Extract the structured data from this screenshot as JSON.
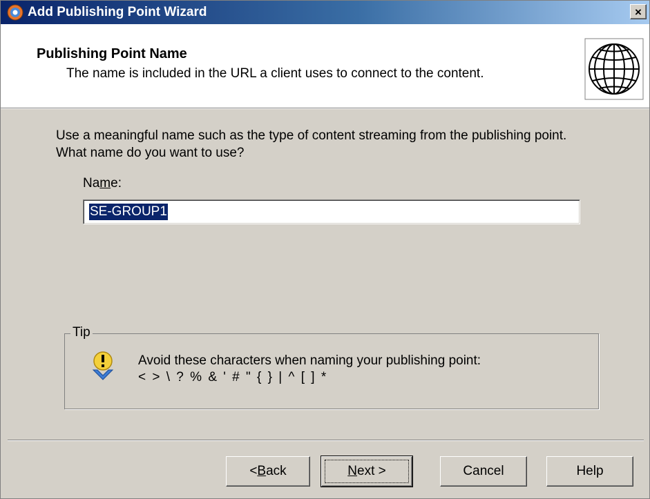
{
  "window": {
    "title": "Add Publishing Point Wizard",
    "close_glyph": "×",
    "titlebar_color_start": "#0a246a",
    "titlebar_color_end": "#a6caf0"
  },
  "header": {
    "title": "Publishing Point Name",
    "subtitle": "The name is included in the URL a client uses to connect to the content.",
    "icon": "globe-icon"
  },
  "body": {
    "intro": "Use a meaningful name such as the type of content streaming from the publishing point. What name do you want to use?",
    "name_label_pre": "Na",
    "name_label_key": "m",
    "name_label_post": "e:",
    "name_value": "SE-GROUP1",
    "selection_color": "#0a246a"
  },
  "tip": {
    "legend": "Tip",
    "icon": "warning-icon",
    "line1": "Avoid these characters when naming your publishing point:",
    "line2": "< > \\ ? % & ' # \" { } | ^ [ ] *"
  },
  "buttons": {
    "back_pre": "< ",
    "back_key": "B",
    "back_post": "ack",
    "next_key": "N",
    "next_post": "ext >",
    "cancel": "Cancel",
    "help": "Help"
  }
}
